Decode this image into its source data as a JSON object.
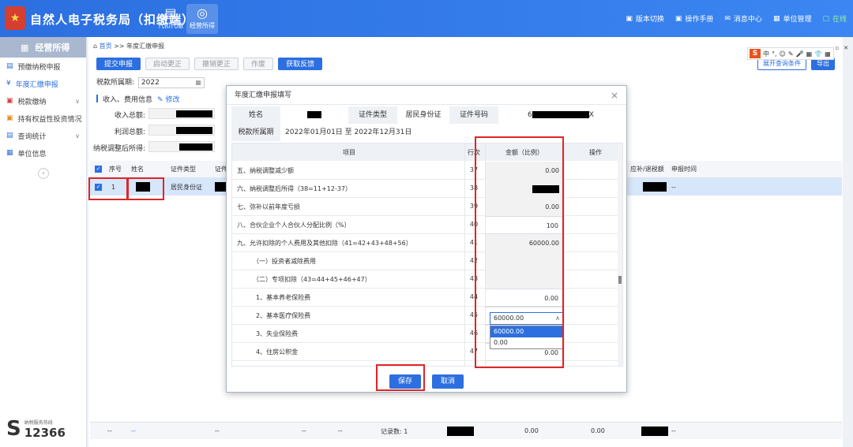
{
  "header": {
    "app_title": "自然人电子税务局（扣缴端）",
    "tabs": [
      {
        "label": "代扣代缴",
        "icon": "folder-icon"
      },
      {
        "label": "经营所得",
        "icon": "coins-icon"
      }
    ],
    "top_right": [
      "版本切换",
      "操作手册",
      "消息中心",
      "单位管理",
      "在线"
    ]
  },
  "sidebar": {
    "title": "经营所得",
    "items": [
      {
        "label": "预缴纳税申报",
        "icon": "document-icon"
      },
      {
        "label": "年度汇缴申报",
        "icon": "yen-icon"
      },
      {
        "label": "税款缴纳",
        "icon": "payment-icon"
      },
      {
        "label": "持有权益性投资情况",
        "icon": "briefcase-icon"
      },
      {
        "label": "查询统计",
        "icon": "search-doc-icon"
      },
      {
        "label": "单位信息",
        "icon": "building-icon"
      }
    ],
    "hotline_label": "纳税服务热线",
    "hotline_number": "12366"
  },
  "main": {
    "breadcrumb": {
      "home": "首页",
      "sep": ">>",
      "current": "年度汇缴申报"
    },
    "buttons": [
      "提交申报",
      "启动更正",
      "撤销更正",
      "作废",
      "获取反馈"
    ],
    "period_label": "税款所属期:",
    "period_value": "2022",
    "section_title": "收入、费用信息",
    "edit_label": "修改",
    "info_labels": [
      "收入总额:",
      "利润总额:",
      "纳税调整后所得:"
    ],
    "right_buttons": [
      "展开查询条件",
      "导出"
    ],
    "table_headers": [
      "序号",
      "姓名",
      "证件类型",
      "证件",
      "应补/退税额",
      "申报时间"
    ],
    "row": {
      "seq": "1",
      "id_type": "居民身份证",
      "refund": "",
      "time": "--"
    },
    "footer": {
      "cells": [
        "--",
        "--",
        "--",
        "--",
        "--"
      ],
      "records_label": "记录数: 1",
      "amt1": "0.00",
      "amt2": "0.00",
      "last": "--"
    }
  },
  "ime": {
    "items": [
      "中",
      "°,",
      "☺",
      "✎",
      "🎤",
      "▦",
      "👕",
      "▦"
    ]
  },
  "modal": {
    "title": "年度汇缴申报填写",
    "close": "×",
    "info": {
      "name_label": "姓名",
      "id_type_label": "证件类型",
      "id_type_value": "居民身份证",
      "id_no_label": "证件号码",
      "id_no_prefix": "6",
      "id_no_suffix": "X",
      "period_label": "税款所属期",
      "period_value": "2022年01月01日 至 2022年12月31日"
    },
    "columns": [
      "项目",
      "行次",
      "金额（比例）",
      "操作"
    ],
    "rows": [
      {
        "name": "五、纳税调整减少额",
        "seq": "37",
        "amount": "0.00",
        "mode": "readonly"
      },
      {
        "name": "六、纳税调整后所得（38=11+12-37）",
        "seq": "38",
        "amount": "",
        "mode": "redacted"
      },
      {
        "name": "七、弥补以前年度亏损",
        "seq": "39",
        "amount": "0.00",
        "mode": "readonly"
      },
      {
        "name": "八、合伙企业个人合伙人分配比例（%）",
        "seq": "40",
        "amount": "100",
        "mode": "editable"
      },
      {
        "name": "九、允许扣除的个人费用及其他扣除（41=42+43+48+56）",
        "seq": "41",
        "amount": "60000.00",
        "mode": "readonly"
      },
      {
        "name": "（一）投资者减除费用",
        "seq": "42",
        "amount": "",
        "mode": "dropdown"
      },
      {
        "name": "（二）专项扣除（43=44+45+46+47）",
        "seq": "43",
        "amount": "",
        "mode": "readonly"
      },
      {
        "name": "1、基本养老保险费",
        "seq": "44",
        "amount": "0.00",
        "mode": "editable"
      },
      {
        "name": "2、基本医疗保险费",
        "seq": "45",
        "amount": "0.00",
        "mode": "editable"
      },
      {
        "name": "3、失业保险费",
        "seq": "46",
        "amount": "0.00",
        "mode": "editable"
      },
      {
        "name": "4、住房公积金",
        "seq": "47",
        "amount": "0.00",
        "mode": "editable"
      }
    ],
    "dropdown": {
      "selected": "60000.00",
      "options": [
        "60000.00",
        "0.00"
      ]
    },
    "save_label": "保存",
    "cancel_label": "取消"
  },
  "colors": {
    "primary": "#2c6fe0",
    "highlight_red": "#e02525",
    "header_blue": "#3b86f2"
  }
}
